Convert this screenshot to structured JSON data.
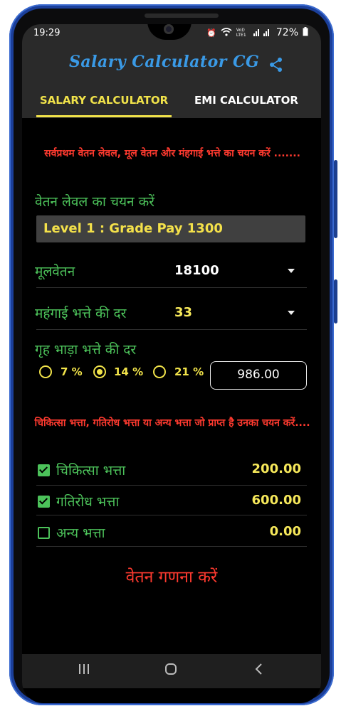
{
  "status": {
    "time": "19:29",
    "volte": "Vo)) LTE1",
    "battery": "72%"
  },
  "app": {
    "title": "Salary Calculator CG",
    "accent": "#f1e34a"
  },
  "tabs": [
    {
      "label": "SALARY CALCULATOR",
      "active": true
    },
    {
      "label": "EMI CALCULATOR",
      "active": false
    }
  ],
  "instruction1": "सर्वप्रथम वेतन लेवल, मूल वेतन और मंहगाई भत्ते का चयन करें .......",
  "level_label": "वेतन लेवल का चयन करें",
  "level_value": "Level 1 : Grade Pay 1300",
  "basic": {
    "label": "मूलवेतन",
    "value": "18100"
  },
  "da": {
    "label": "महंगाई भत्ते की दर",
    "value": "33"
  },
  "hra": {
    "label": "गृह भाड़ा भत्ते की दर",
    "options": [
      {
        "label": "7 %",
        "selected": false
      },
      {
        "label": "14 %",
        "selected": true
      },
      {
        "label": "21 %",
        "selected": false
      }
    ],
    "amount": "986.00"
  },
  "instruction2": "चिकित्सा भत्ता, गतिरोध भत्ता या अन्य भत्ता जो प्राप्त है उनका चयन करें....",
  "allowances": [
    {
      "label": "चिकित्सा भत्ता",
      "checked": true,
      "value": "200.00"
    },
    {
      "label": "गतिरोध भत्ता",
      "checked": true,
      "value": "600.00"
    },
    {
      "label": "अन्य भत्ता",
      "checked": false,
      "value": "0.00"
    }
  ],
  "calculate_label": "वेतन गणना करें"
}
